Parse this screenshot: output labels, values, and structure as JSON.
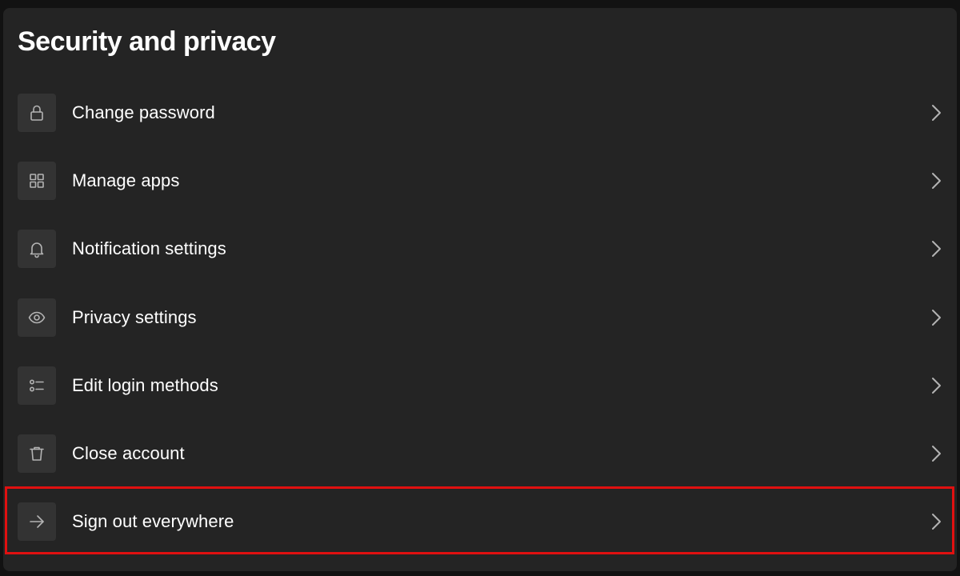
{
  "page": {
    "title": "Security and privacy"
  },
  "menu": {
    "items": [
      {
        "label": "Change password",
        "icon": "lock-icon"
      },
      {
        "label": "Manage apps",
        "icon": "apps-grid-icon"
      },
      {
        "label": "Notification settings",
        "icon": "bell-icon"
      },
      {
        "label": "Privacy settings",
        "icon": "eye-icon"
      },
      {
        "label": "Edit login methods",
        "icon": "list-icon"
      },
      {
        "label": "Close account",
        "icon": "trash-icon"
      },
      {
        "label": "Sign out everywhere",
        "icon": "arrow-right-icon"
      }
    ]
  },
  "colors": {
    "background": "#121212",
    "panel": "#242424",
    "icon_box": "#333333",
    "text": "#ffffff",
    "icon": "#b3b3b3",
    "highlight": "#e01010"
  },
  "highlighted_item": "Sign out everywhere"
}
